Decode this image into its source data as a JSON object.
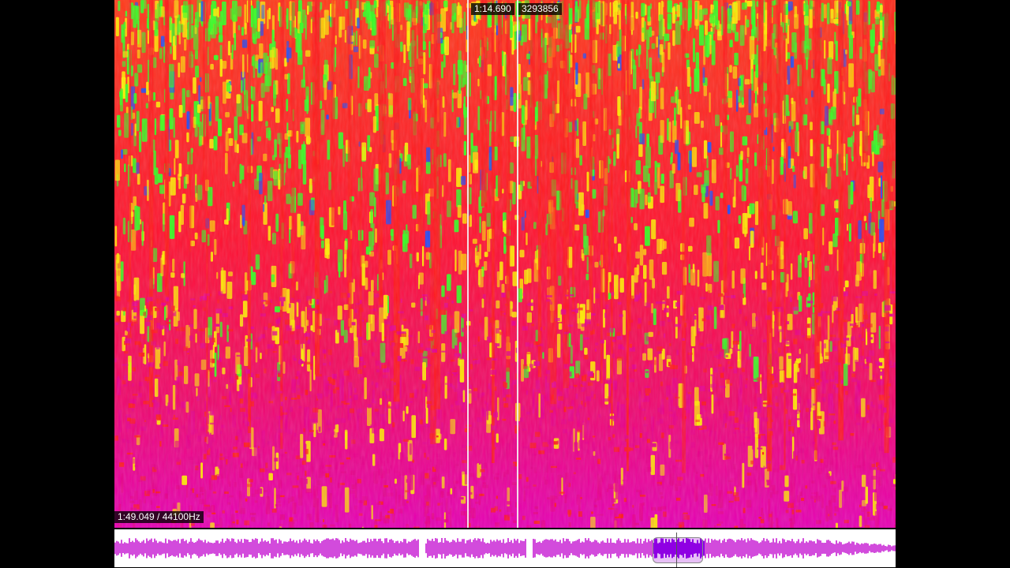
{
  "spectrogram": {
    "cursor_time": "1:14.690",
    "cursor_sample": "3293856",
    "duration_samplerate": "1:49.049 / 44100Hz",
    "colors": {
      "low": "#e8008a",
      "mid": "#ff1a1a",
      "high": "#ffee00",
      "peak": "#33ff22",
      "extreme": "#1a4dff"
    }
  },
  "overview": {
    "waveform_color": "#d24bdc",
    "selection_color": "#8a00e6"
  }
}
